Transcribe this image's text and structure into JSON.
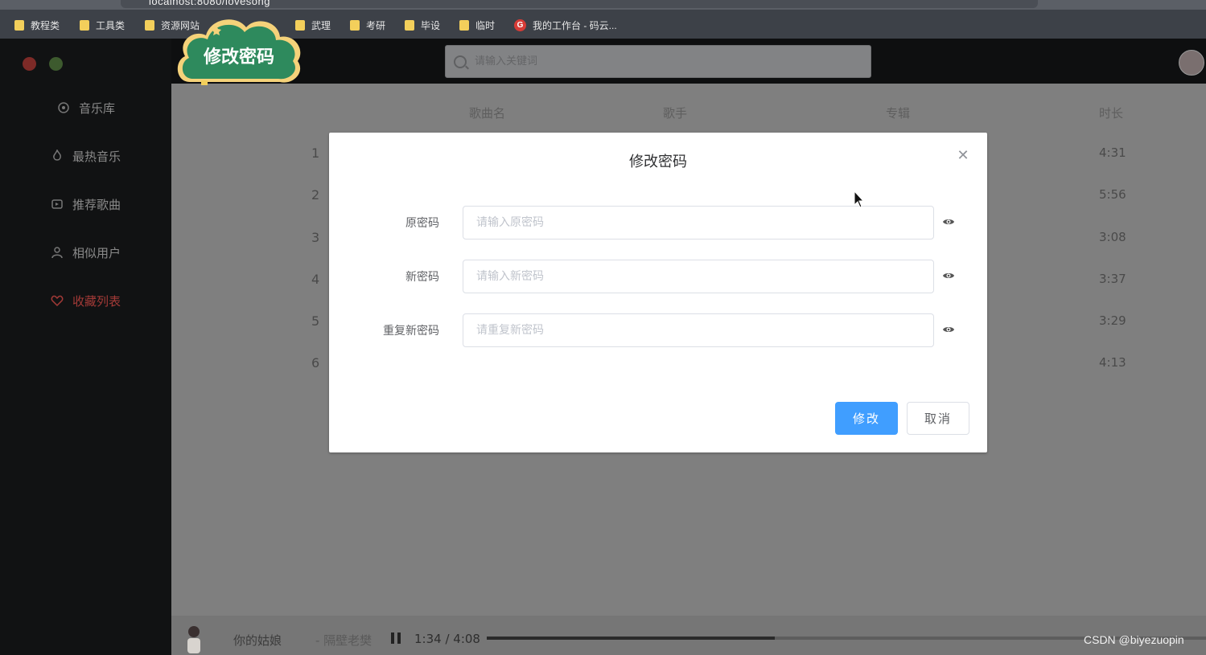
{
  "browser": {
    "url": "localhost:8080/lovesong",
    "bookmarks": [
      {
        "label": "教程类",
        "icon": "folder-icon"
      },
      {
        "label": "工具类",
        "icon": "folder-icon"
      },
      {
        "label": "资源网站",
        "icon": "folder-icon"
      },
      {
        "label": "武理",
        "icon": "folder-icon"
      },
      {
        "label": "考研",
        "icon": "folder-icon"
      },
      {
        "label": "毕设",
        "icon": "folder-icon"
      },
      {
        "label": "临时",
        "icon": "folder-icon"
      },
      {
        "label": "我的工作台 - 码云...",
        "icon": "gitee-icon"
      }
    ]
  },
  "sticker": {
    "text": "修改密码"
  },
  "sidebar": {
    "items": [
      {
        "label": "音乐库",
        "icon": "music-library-icon",
        "active": false
      },
      {
        "label": "最热音乐",
        "icon": "hot-music-icon",
        "active": false
      },
      {
        "label": "推荐歌曲",
        "icon": "recommend-icon",
        "active": false
      },
      {
        "label": "相似用户",
        "icon": "user-icon",
        "active": false
      },
      {
        "label": "收藏列表",
        "icon": "heart-icon",
        "active": true
      }
    ]
  },
  "search": {
    "placeholder": "请输入关键词"
  },
  "table": {
    "headers": [
      "歌曲名",
      "歌手",
      "专辑",
      "时长"
    ],
    "rows": [
      {
        "index": "1",
        "duration": "4:31"
      },
      {
        "index": "2",
        "duration": "5:56"
      },
      {
        "index": "3",
        "duration": "3:08"
      },
      {
        "index": "4",
        "duration": "3:37"
      },
      {
        "index": "5",
        "duration": "3:29"
      },
      {
        "index": "6",
        "duration": "4:13"
      }
    ]
  },
  "modal": {
    "title": "修改密码",
    "fields": [
      {
        "label": "原密码",
        "placeholder": "请输入原密码",
        "value": ""
      },
      {
        "label": "新密码",
        "placeholder": "请输入新密码",
        "value": ""
      },
      {
        "label": "重复新密码",
        "placeholder": "请重复新密码",
        "value": ""
      }
    ],
    "confirm_label": "修改",
    "cancel_label": "取消"
  },
  "player": {
    "song": "你的姑娘",
    "artist": "- 隔壁老樊",
    "time": "1:34 / 4:08",
    "progress": 0.4
  },
  "watermark": "CSDN @biyezuopin",
  "colors": {
    "primary": "#409eff",
    "active_nav": "#a33a37",
    "sticker_green": "#2e8a5d",
    "sticker_border": "#f5d27a"
  }
}
